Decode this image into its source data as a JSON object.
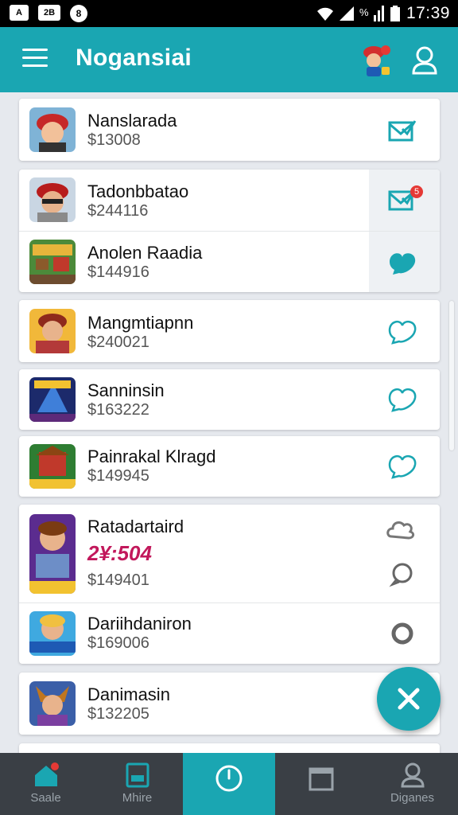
{
  "status_bar": {
    "time": "17:39",
    "left_icon_1": "A",
    "left_icon_2": "2B",
    "left_icon_3": "8",
    "battery_pct": "%"
  },
  "app_bar": {
    "title": "Nogansiai"
  },
  "list": [
    {
      "name": "Nanslarada",
      "price": "$13008"
    },
    {
      "name": "Tadonbbatao",
      "price": "$244116"
    },
    {
      "name": "Anolen Raadia",
      "price": "$144916"
    },
    {
      "name": "Mangmtiapnn",
      "price": "$240021"
    },
    {
      "name": "Sanninsin",
      "price": "$163222"
    },
    {
      "name": "Painrakal Klragd",
      "price": "$149945"
    },
    {
      "name": "Ratadartaird",
      "promo": "2¥:504",
      "price": "$149401"
    },
    {
      "name": "Dariihdaniron",
      "price": "$169006"
    },
    {
      "name": "Danimasin",
      "price": "$132205"
    }
  ],
  "badge_count": "5",
  "bottom_nav": [
    {
      "label": "Saale"
    },
    {
      "label": "Mhire"
    },
    {
      "label": ""
    },
    {
      "label": ""
    },
    {
      "label": "Diganes"
    }
  ],
  "colors": {
    "accent": "#1aa6b2",
    "nav_bg": "#3a3f45",
    "badge": "#e53935"
  }
}
